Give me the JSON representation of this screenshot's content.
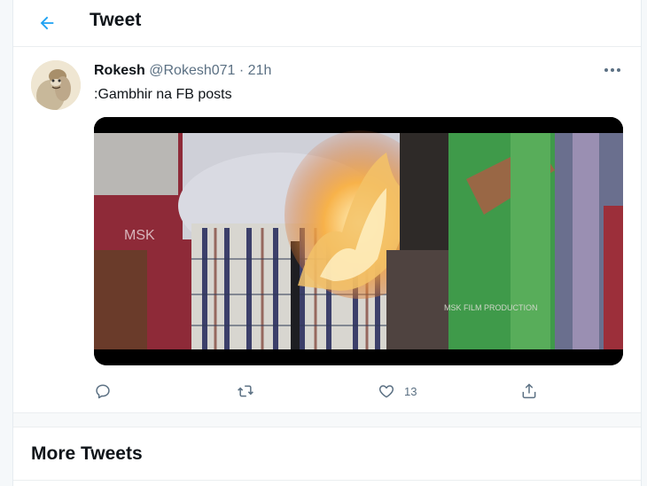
{
  "header": {
    "title": "Tweet",
    "back_icon": "arrow-left-icon"
  },
  "tweet": {
    "display_name": "Rokesh",
    "handle": "@Rokesh071",
    "separator": "·",
    "time": "21h",
    "text": ":Gambhir na FB posts",
    "more_icon": "more-horizontal-icon",
    "media": {
      "watermark_left": "MSK",
      "watermark_right": "MSK FILM PRODUCTION"
    },
    "actions": {
      "reply_icon": "reply-icon",
      "retweet_icon": "retweet-icon",
      "like_icon": "heart-icon",
      "like_count": "13",
      "share_icon": "share-icon"
    }
  },
  "more_tweets": {
    "title": "More Tweets"
  },
  "colors": {
    "accent": "#1da1f2",
    "secondary_text": "#5b7083",
    "border": "#ebeef0"
  }
}
